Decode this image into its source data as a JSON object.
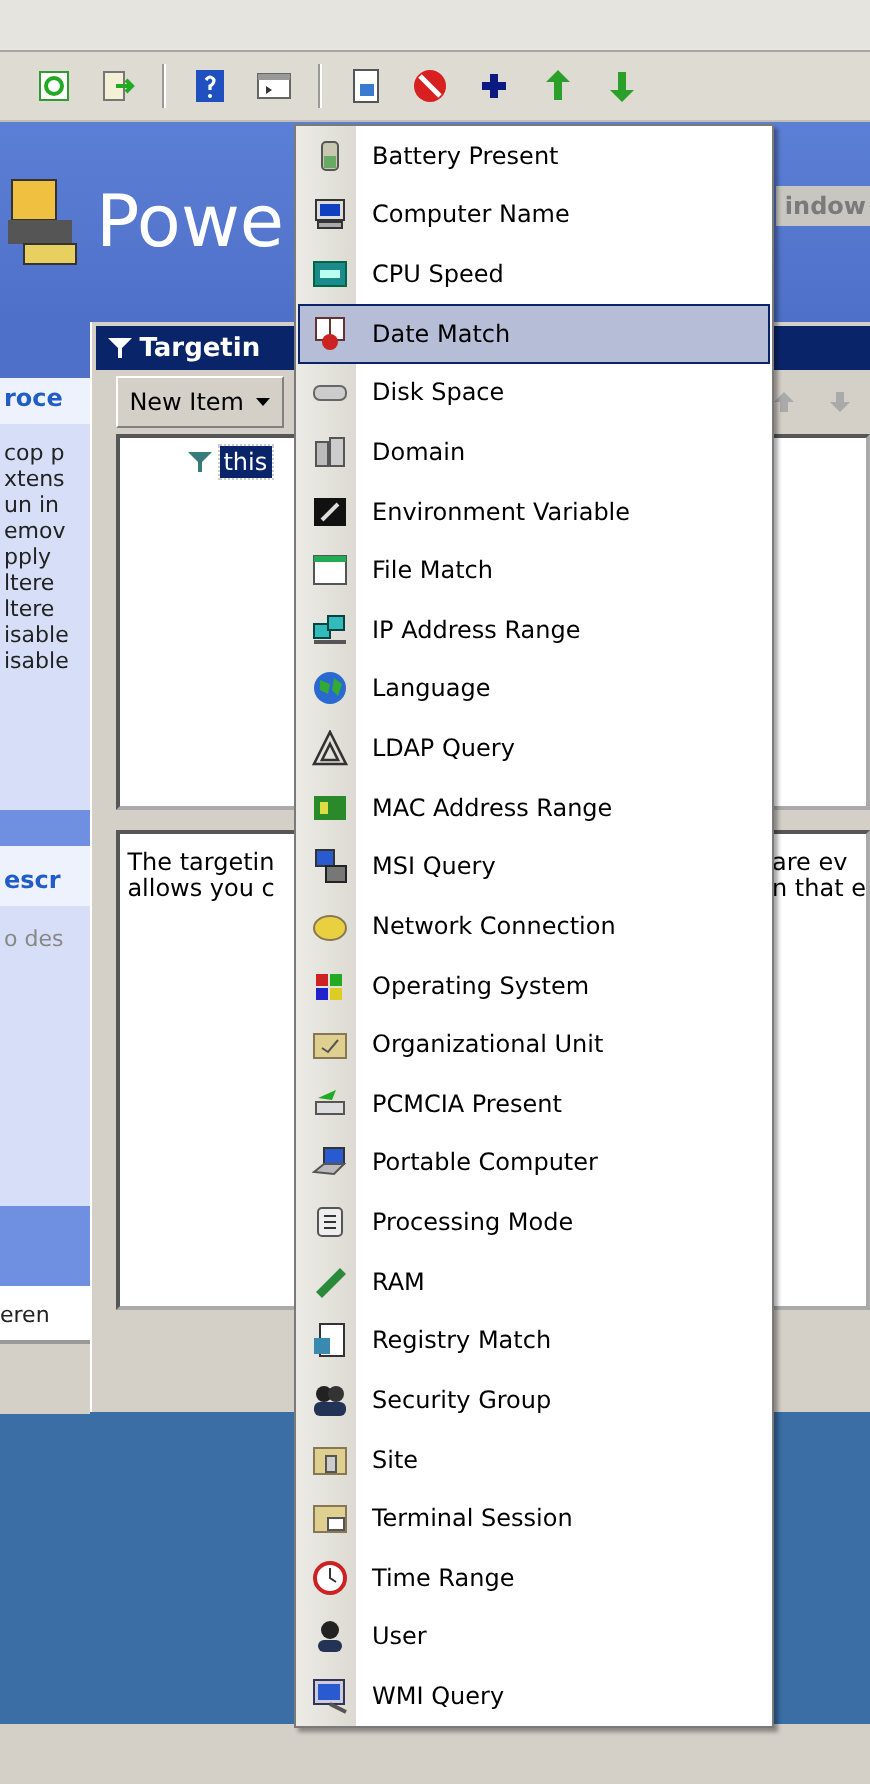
{
  "header": {
    "title": "Powe",
    "tab": "indow"
  },
  "left_pane": {
    "heading": "roce",
    "lines": [
      "cop p",
      "xtens",
      "un in",
      "emov",
      "pply",
      "ltere",
      "ltere",
      "isable",
      "isable"
    ],
    "section_heading": "escr",
    "section_text": "o des",
    "footer": "eren"
  },
  "dialog": {
    "title": "Targetin",
    "new_item_button": "New Item",
    "tree": [
      {
        "label": "this",
        "selected": true
      }
    ],
    "description": {
      "left_lines": [
        "The targetin",
        "allows you c"
      ],
      "right_lines": [
        "are ev",
        "n that e"
      ]
    }
  },
  "menu": {
    "items": [
      {
        "label": "Battery Present",
        "selected": false
      },
      {
        "label": "Computer Name",
        "selected": false
      },
      {
        "label": "CPU Speed",
        "selected": false
      },
      {
        "label": "Date Match",
        "selected": true
      },
      {
        "label": "Disk Space",
        "selected": false
      },
      {
        "label": "Domain",
        "selected": false
      },
      {
        "label": "Environment Variable",
        "selected": false
      },
      {
        "label": "File Match",
        "selected": false
      },
      {
        "label": "IP Address Range",
        "selected": false
      },
      {
        "label": "Language",
        "selected": false
      },
      {
        "label": "LDAP Query",
        "selected": false
      },
      {
        "label": "MAC Address Range",
        "selected": false
      },
      {
        "label": "MSI Query",
        "selected": false
      },
      {
        "label": "Network Connection",
        "selected": false
      },
      {
        "label": "Operating System",
        "selected": false
      },
      {
        "label": "Organizational Unit",
        "selected": false
      },
      {
        "label": "PCMCIA Present",
        "selected": false
      },
      {
        "label": "Portable Computer",
        "selected": false
      },
      {
        "label": "Processing Mode",
        "selected": false
      },
      {
        "label": "RAM",
        "selected": false
      },
      {
        "label": "Registry Match",
        "selected": false
      },
      {
        "label": "Security Group",
        "selected": false
      },
      {
        "label": "Site",
        "selected": false
      },
      {
        "label": "Terminal Session",
        "selected": false
      },
      {
        "label": "Time Range",
        "selected": false
      },
      {
        "label": "User",
        "selected": false
      },
      {
        "label": "WMI Query",
        "selected": false
      }
    ]
  }
}
